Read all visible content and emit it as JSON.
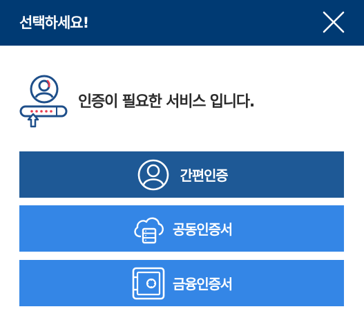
{
  "header": {
    "title": "선택하세요!",
    "close_icon": "close-icon"
  },
  "info": {
    "icon": "user-password-login-icon",
    "message": "인증이 필요한 서비스 입니다."
  },
  "buttons": [
    {
      "label": "간편인증",
      "icon": "user-circle-icon"
    },
    {
      "label": "공동인증서",
      "icon": "cloud-server-icon"
    },
    {
      "label": "금융인증서",
      "icon": "safe-icon"
    }
  ],
  "colors": {
    "header_bg": "#003a73",
    "primary_button": "#1e5996",
    "secondary_button": "#3486e6",
    "icon_accent": "#e83a4e",
    "icon_main": "#1e4f8a"
  }
}
